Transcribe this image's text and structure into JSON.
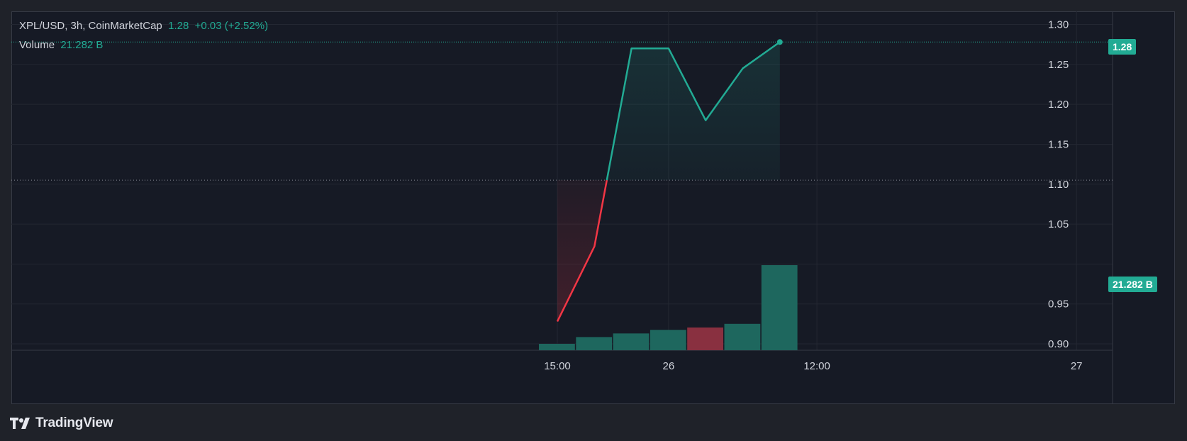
{
  "legend": {
    "symbol": "XPL/USD, 3h, CoinMarketCap",
    "last": "1.28",
    "change": "+0.03 (+2.52%)",
    "volume_label": "Volume",
    "volume_value": "21.282 B"
  },
  "badges": {
    "price": "1.28",
    "volume": "21.282 B"
  },
  "brand": {
    "name": "TradingView"
  },
  "colors": {
    "up": "#22ab94",
    "down": "#f23645",
    "volume_up": "#1e675e",
    "volume_down": "#893040",
    "background": "#161a25",
    "grid": "#232732",
    "text": "#d1d4dc"
  },
  "chart_data": {
    "type": "line",
    "title": "XPL/USD, 3h, CoinMarketCap",
    "baseline": 1.105,
    "x_ticks": [
      "15:00",
      "26",
      "12:00",
      "27"
    ],
    "y_ticks": [
      "1.30",
      "1.25",
      "1.20",
      "1.15",
      "1.10",
      "1.05",
      "0.95",
      "0.90"
    ],
    "ylim": [
      0.9,
      1.3
    ],
    "series": [
      {
        "name": "XPL/USD",
        "x": [
          "25 15:00",
          "25 18:00",
          "25 21:00",
          "26 00:00",
          "26 03:00",
          "26 06:00",
          "26 09:00"
        ],
        "values": [
          0.928,
          1.022,
          1.27,
          1.27,
          1.18,
          1.245,
          1.278
        ]
      },
      {
        "name": "Volume",
        "x": [
          "25 15:00",
          "25 18:00",
          "25 21:00",
          "26 00:00",
          "26 03:00",
          "26 06:00",
          "26 09:00"
        ],
        "values": [
          1.6,
          3.3,
          4.2,
          5.1,
          5.7,
          6.6,
          21.282
        ],
        "direction": [
          "up",
          "up",
          "up",
          "up",
          "down",
          "up",
          "up"
        ],
        "unit": "B"
      }
    ],
    "grid": true
  }
}
